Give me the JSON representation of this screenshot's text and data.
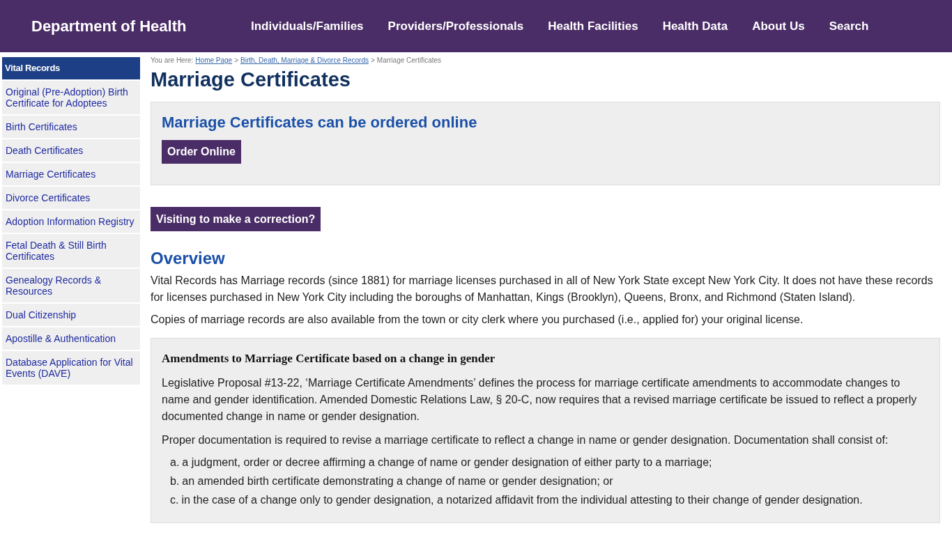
{
  "header": {
    "site_title": "Department of Health",
    "nav": [
      "Individuals/Families",
      "Providers/Professionals",
      "Health Facilities",
      "Health Data",
      "About Us",
      "Search"
    ]
  },
  "sidebar": {
    "heading": "Vital Records",
    "items": [
      {
        "label": "Original (Pre-Adoption) Birth Certificate for Adoptees"
      },
      {
        "label": "Birth Certificates"
      },
      {
        "label": "Death Certificates"
      },
      {
        "label": "Marriage Certificates"
      },
      {
        "label": "Divorce Certificates"
      },
      {
        "label": "Adoption Information Registry"
      },
      {
        "label": "Fetal Death & Still Birth Certificates"
      },
      {
        "label": "Genealogy Records & Resources"
      },
      {
        "label": "Dual Citizenship"
      },
      {
        "label": "Apostille & Authentication"
      },
      {
        "label": "Database Application for Vital Events (DAVE)"
      }
    ]
  },
  "breadcrumb": {
    "prefix": "You are Here:",
    "links": [
      "Home Page",
      "Birth, Death, Marriage & Divorce Records"
    ],
    "separator": ">",
    "current": "Marriage Certificates"
  },
  "page_title": "Marriage Certificates",
  "order_panel": {
    "heading": "Marriage Certificates can be ordered online",
    "button": "Order Online"
  },
  "correction_button": "Visiting to make a correction?",
  "overview": {
    "heading": "Overview",
    "paragraphs": [
      "Vital Records has Marriage records (since 1881) for marriage licenses purchased in all of New York State except New York City. It does not have these records for licenses purchased in New York City including the boroughs of Manhattan, Kings (Brooklyn), Queens, Bronx, and Richmond (Staten Island).",
      "Copies of marriage records are also available from the town or city clerk where you purchased (i.e., applied for) your original license."
    ]
  },
  "amendments": {
    "heading": "Amendments to Marriage Certificate based on a change in gender",
    "paragraphs": [
      "Legislative Proposal #13-22, ‘Marriage Certificate Amendments’ defines the process for marriage certificate amendments to accommodate changes to name and gender identification. Amended Domestic Relations Law, § 20-C, now requires that a revised marriage certificate be issued to reflect a properly documented change in name or gender designation.",
      "Proper documentation is required to revise a marriage certificate to reflect a change in name or gender designation. Documentation shall consist of:"
    ],
    "list": [
      {
        "marker": "a.",
        "text": "a judgment, order or decree affirming a change of name or gender designation of either party to a marriage;"
      },
      {
        "marker": "b.",
        "text": "an amended birth certificate demonstrating a change of name or gender designation; or"
      },
      {
        "marker": "c.",
        "text": "in the case of a change only to gender designation, a notarized affidavit from the individual attesting to their change of gender designation."
      }
    ]
  }
}
